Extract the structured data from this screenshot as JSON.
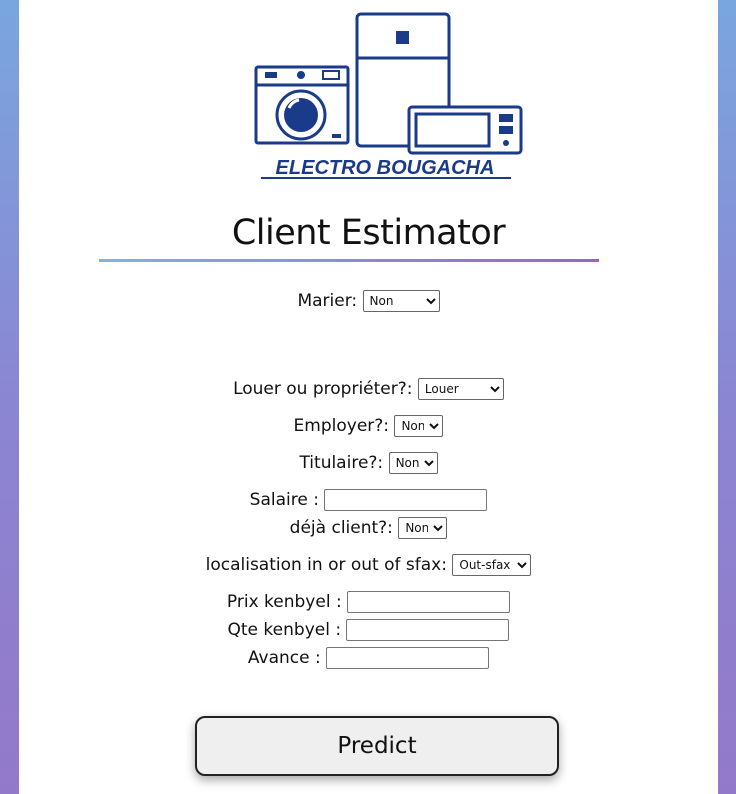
{
  "logo": {
    "brand": "ELECTRO BOUGACHA"
  },
  "title": "Client Estimator",
  "form": {
    "marier": {
      "label": "Marier:",
      "value": "Non"
    },
    "louer": {
      "label": "Louer ou propriéter?:",
      "value": "Louer"
    },
    "employer": {
      "label": "Employer?:",
      "value": "Non"
    },
    "titulaire": {
      "label": "Titulaire?:",
      "value": "Non"
    },
    "salaire": {
      "label": "Salaire :",
      "value": ""
    },
    "deja_client": {
      "label": "déjà client?:",
      "value": "Non"
    },
    "localisation": {
      "label": "localisation in or out of sfax:",
      "value": "Out-sfax"
    },
    "prix": {
      "label": "Prix kenbyel :",
      "value": ""
    },
    "qte": {
      "label": "Qte kenbyel :",
      "value": ""
    },
    "avance": {
      "label": "Avance :",
      "value": ""
    }
  },
  "predict_button": "Predict",
  "colors": {
    "logo_blue": "#1a3a8a",
    "underline_start": "#7cb6e0",
    "underline_end": "#9d62c4"
  }
}
